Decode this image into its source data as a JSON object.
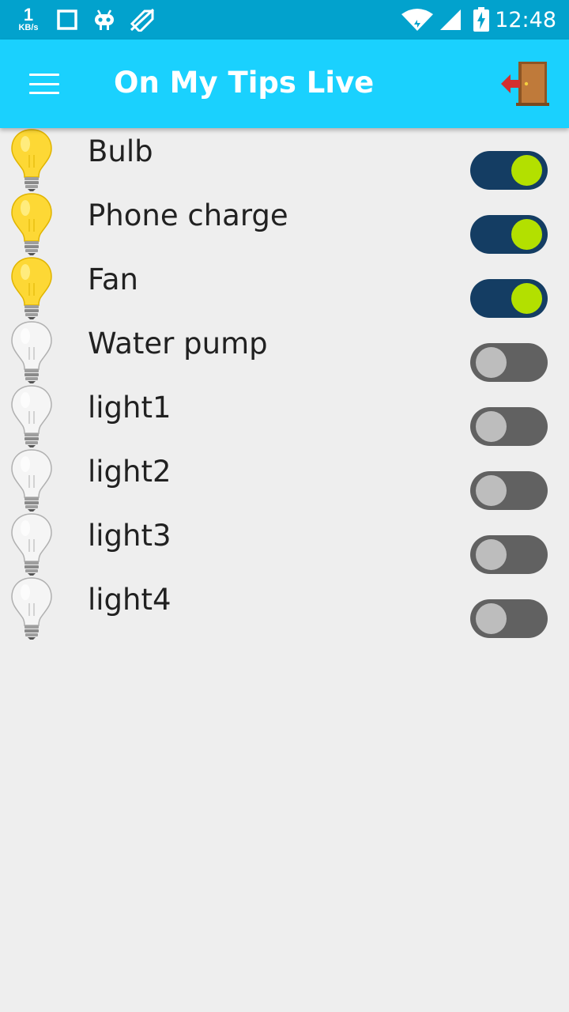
{
  "status_bar": {
    "speed_value": "1",
    "speed_unit": "KB/s",
    "time": "12:48",
    "icons": [
      "square-icon",
      "android-icon",
      "no-location-icon",
      "wifi-icon",
      "signal-icon",
      "battery-charging-icon"
    ]
  },
  "app_bar": {
    "title": "On My Tips Live",
    "menu_icon": "hamburger-menu-icon",
    "exit_icon": "exit-door-icon"
  },
  "devices": [
    {
      "name": "Bulb",
      "on": true
    },
    {
      "name": "Phone charge",
      "on": true
    },
    {
      "name": "Fan",
      "on": true
    },
    {
      "name": "Water pump",
      "on": false
    },
    {
      "name": "light1",
      "on": false
    },
    {
      "name": "light2",
      "on": false
    },
    {
      "name": "light3",
      "on": false
    },
    {
      "name": "light4",
      "on": false
    }
  ],
  "colors": {
    "status_bar": "#02a2cd",
    "app_bar": "#1ad1fe",
    "switch_on_track": "#143d63",
    "switch_on_thumb": "#b3e000",
    "switch_off_track": "#616161",
    "switch_off_thumb": "#bdbdbd",
    "bulb_on": "#fdd835",
    "bulb_off": "#f5f5f5"
  }
}
